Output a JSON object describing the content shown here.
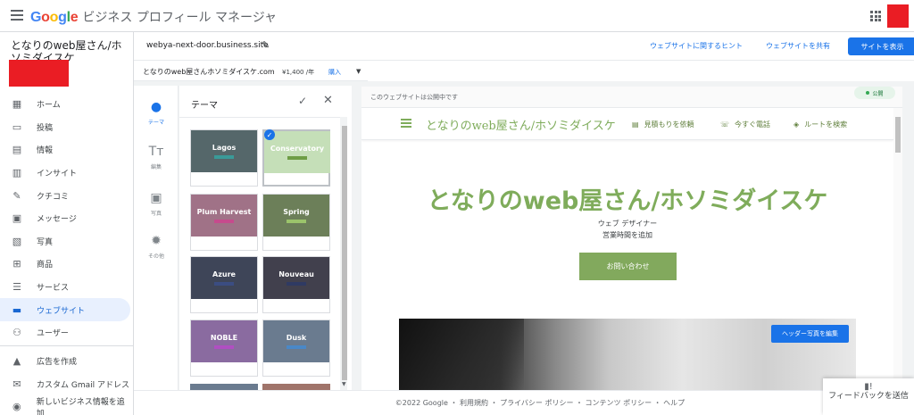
{
  "app": {
    "logo_text": "Google",
    "product_name": "ビジネス プロフィール マネージャ"
  },
  "sidebar": {
    "business_name": "となりのweb屋さん/ホソミダイスケ",
    "items": [
      {
        "label": "ホーム",
        "icon": "dashboard-icon"
      },
      {
        "label": "投稿",
        "icon": "posts-icon"
      },
      {
        "label": "情報",
        "icon": "info-icon"
      },
      {
        "label": "インサイト",
        "icon": "insights-icon"
      },
      {
        "label": "クチコミ",
        "icon": "reviews-icon"
      },
      {
        "label": "メッセージ",
        "icon": "message-icon"
      },
      {
        "label": "写真",
        "icon": "photos-icon"
      },
      {
        "label": "商品",
        "icon": "products-icon"
      },
      {
        "label": "サービス",
        "icon": "services-icon"
      },
      {
        "label": "ウェブサイト",
        "icon": "website-icon",
        "active": true
      },
      {
        "label": "ユーザー",
        "icon": "add-user-icon"
      }
    ],
    "bottom_items": [
      {
        "label": "広告を作成",
        "icon": "ads-icon"
      },
      {
        "label": "カスタム Gmail アドレス",
        "icon": "gmail-icon"
      },
      {
        "label": "新しいビジネス情報を追加",
        "icon": "location-icon"
      }
    ]
  },
  "site_header": {
    "url": "webya-next-door.business.site",
    "hint_link": "ウェブサイトに関するヒント",
    "share_link": "ウェブサイトを共有",
    "view_button": "サイトを表示"
  },
  "domain": {
    "name": "となりのweb屋さんホソミダイスケ.com",
    "price": "¥1,400 /年",
    "buy_label": "購入"
  },
  "tools": [
    {
      "label": "テーマ",
      "icon": "palette-icon",
      "active": true
    },
    {
      "label": "編集",
      "icon": "text-edit-icon"
    },
    {
      "label": "写真",
      "icon": "add-photo-icon"
    },
    {
      "label": "その他",
      "icon": "settings-icon"
    }
  ],
  "theme_panel": {
    "title": "テーマ",
    "themes": [
      {
        "name": "Lagos",
        "bg": "#55676a",
        "bar": "#3a9a98",
        "fg": "#ffffff"
      },
      {
        "name": "Conservatory",
        "bg": "#c5dfb8",
        "bar": "#6e9d45",
        "fg": "#ffffff",
        "selected": true
      },
      {
        "name": "Plum Harvest",
        "bg": "#a07287",
        "bar": "#c64b8d",
        "fg": "#ffffff"
      },
      {
        "name": "Spring",
        "bg": "#6c7f59",
        "bar": "#9bc46b",
        "fg": "#ffffff"
      },
      {
        "name": "Azure",
        "bg": "#3e4558",
        "bar": "#3b4d82",
        "fg": "#ffffff"
      },
      {
        "name": "Nouveau",
        "bg": "#41404d",
        "bar": "#2f3a63",
        "fg": "#ffffff"
      },
      {
        "name": "NOBLE",
        "bg": "#8a6ba0",
        "bar": "#b04fc2",
        "fg": "#ffffff"
      },
      {
        "name": "Dusk",
        "bg": "#6a7b8f",
        "bar": "#4a88c7",
        "fg": "#ffffff"
      }
    ]
  },
  "preview": {
    "published_note": "このウェブサイトは公開中です",
    "status_chip": "公開",
    "site_title": "となりのweb屋さん/ホソミダイスケ",
    "nav_links": [
      {
        "label": "見積もりを依頼",
        "icon": "quote-icon"
      },
      {
        "label": "今すぐ電話",
        "icon": "phone-icon"
      },
      {
        "label": "ルートを検索",
        "icon": "directions-icon"
      }
    ],
    "hero_title": "となりのweb屋さん/ホソミダイスケ",
    "category": "ウェブ デザイナー",
    "hours": "営業時間を追加",
    "contact_button": "お問い合わせ",
    "edit_header_photo": "ヘッダー写真を編集"
  },
  "footer": {
    "text": "©2022 Google ・ 利用規約 ・ プライバシー ポリシー ・ コンテンツ ポリシー ・ ヘルプ"
  },
  "feedback": {
    "label": "フィードバックを送信"
  },
  "colors": {
    "accent": "#1a73e8",
    "theme_green": "#7fac5b",
    "avatar_red": "#ea1d24"
  }
}
